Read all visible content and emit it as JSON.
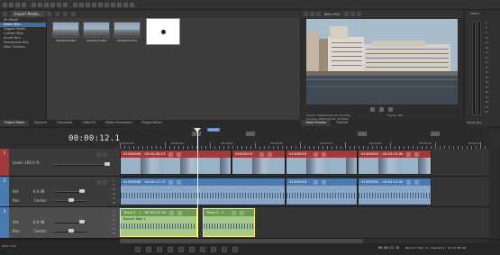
{
  "toolbar": {
    "icons": [
      "new-icon",
      "open-icon",
      "save-icon",
      "properties-icon",
      "cut-icon",
      "copy-icon",
      "paste-icon",
      "delete-icon",
      "undo-icon",
      "redo-icon",
      "normal-edit-icon",
      "envelope-icon",
      "selection-icon",
      "zoom-icon",
      "split-icon",
      "trim-icon",
      "snap-icon",
      "lock-icon",
      "auto-ripple-icon",
      "settings-icon"
    ]
  },
  "explorer": {
    "import_label": "Import Media...",
    "tree": [
      "All Media",
      "Media Bins",
      "Tagged Media",
      "Custom Bins",
      "Smart Bins",
      "Storyboard Bins",
      "Main Timeline"
    ],
    "selected_index": 1,
    "media": [
      {
        "name": "01090006.MP4"
      },
      {
        "name": "01090019.MP4"
      },
      {
        "name": "01090005.MP4"
      },
      {
        "name": ""
      }
    ],
    "status": "Audio: 48,000 Hz; 24 Bit; Stereo; 00:00:25;20; Uncompressed",
    "tabs": [
      "Project Media",
      "Explorer",
      "Transitions",
      "Video FX",
      "Media Generators",
      "Project Notes"
    ],
    "active_tab": 0
  },
  "preview": {
    "mode": "Best (Full)",
    "info_lines": [
      "Project: 3840x2160x32, 25.000p",
      "Preview: 960x540x32, 25.000p",
      "Display: 295x166x32"
    ],
    "frame_label": "Frame:",
    "frame_value": "304",
    "display_label": "Display:",
    "tabs": [
      "Video Preview",
      "Trimmer"
    ]
  },
  "master": {
    "title": "Master",
    "scale": [
      "-3",
      "-6",
      "-9",
      "-12",
      "-15",
      "-18",
      "-21",
      "-24",
      "-27",
      "-30",
      "-33",
      "-36",
      "-39",
      "-42",
      "-45",
      "-48",
      "-51",
      "-54",
      "-57"
    ],
    "footer": "Master Bus"
  },
  "timeline": {
    "timecode": "00:00:12.16",
    "ruler_labels": [
      "00:00:00",
      "00:00:10",
      "00:00:20",
      "00:00:30",
      "00:00:40",
      "00:00:50",
      "00:01:00",
      "00:01:10"
    ],
    "loop_marker": "+1:17",
    "tracks": [
      {
        "num": "1",
        "kind": "video",
        "level_label": "Level:",
        "level_value": "100.0 %",
        "events": [
          {
            "name": "01090006",
            "time": "00:00:28.13"
          },
          {
            "name": "01090019",
            "time": ""
          },
          {
            "name": "01090019",
            "time": ""
          },
          {
            "name": "01090005",
            "time": "00:00:15.00"
          }
        ]
      },
      {
        "num": "2",
        "kind": "audio",
        "vol_label": "Vol:",
        "vol_value": "0.0 dB",
        "pan_label": "Pan:",
        "pan_value": "Center",
        "events": [
          {
            "name": "01090006",
            "time": "00:00:27.13"
          },
          {
            "name": "01090019",
            "time": ""
          },
          {
            "name": "01090005",
            "time": "00:00:15.00"
          }
        ]
      },
      {
        "num": "3",
        "kind": "audio",
        "vol_label": "Vol:",
        "vol_value": "0.0 dB",
        "pan_label": "Pan:",
        "pan_value": "Center",
        "events": [
          {
            "name": "Track 2 - 1",
            "time": "00:00:12.16",
            "subtitle": "Record Take 1"
          },
          {
            "name": "Track 3 - 1",
            "time": "",
            "subtitle": ""
          }
        ]
      }
    ],
    "scroll_labels": [
      "-6",
      "-12",
      "-18",
      "-24",
      "-30",
      "-36",
      "-42"
    ]
  },
  "status": {
    "rate_label": "Rate: 0.00",
    "record_time": "Record Time (2 channels): 14:14:08:20",
    "cursor_time": "00:00:12.16"
  },
  "colors": {
    "video_track": "#a33a3a",
    "audio_track": "#4a7bb0",
    "selected_audio": "#6a9a4e",
    "accent": "#3d6fa6"
  }
}
